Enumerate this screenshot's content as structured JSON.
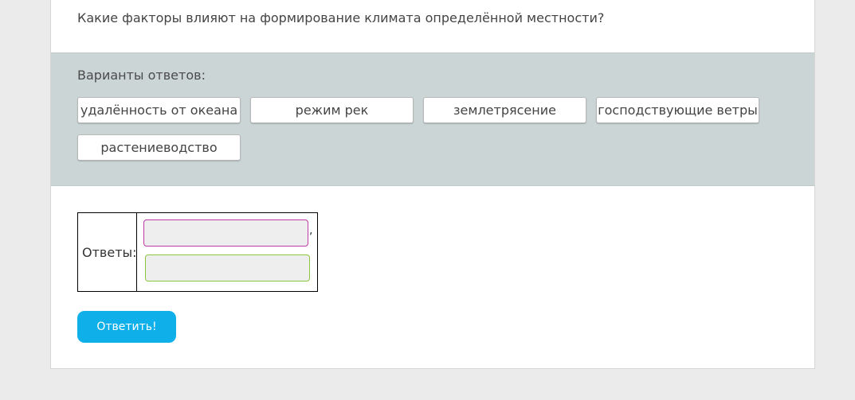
{
  "question": {
    "text": "Какие факторы влияют на формирование климата определённой местности?"
  },
  "options": {
    "title": "Варианты ответов:",
    "items": [
      {
        "label": "удалённость от океана"
      },
      {
        "label": "режим рек"
      },
      {
        "label": "землетрясение"
      },
      {
        "label": "господствующие ветры"
      },
      {
        "label": "растениеводство"
      }
    ]
  },
  "answers": {
    "label": "Ответы:",
    "separator": ",",
    "slot_colors": [
      "#c23aa8",
      "#8cc63e"
    ]
  },
  "submit": {
    "label": "Ответить!",
    "color": "#0fb0ea"
  }
}
